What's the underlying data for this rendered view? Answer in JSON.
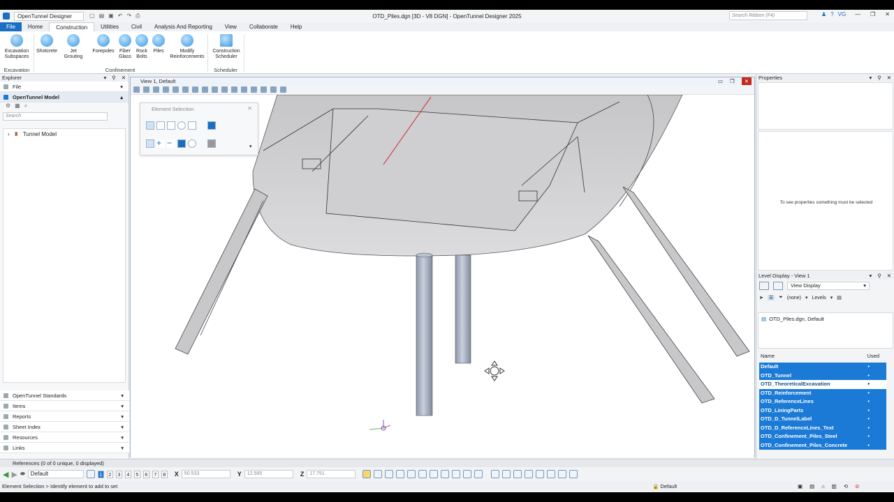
{
  "app": {
    "name": "OpenTunnel Designer",
    "document_title": "OTD_Piles.dgn [3D - V8 DGN] - OpenTunnel Designer 2025",
    "search_placeholder": "Search Ribbon (F4)",
    "user_initials": "VG"
  },
  "tabs": [
    "File",
    "Home",
    "Construction",
    "Utilities",
    "Civil",
    "Analysis And Reporting",
    "View",
    "Collaborate",
    "Help"
  ],
  "active_tab": "Construction",
  "ribbon": {
    "groups": [
      {
        "label": "Excavation",
        "buttons": [
          {
            "label": "Excavation\nSubspaces",
            "icon": "excavation-icon"
          }
        ]
      },
      {
        "label": "Confinement",
        "buttons": [
          {
            "label": "Shotcrete",
            "icon": "shotcrete-icon"
          },
          {
            "label": "Jet\nGrouting",
            "icon": "jet-grouting-icon"
          },
          {
            "label": "Forepoles",
            "icon": "forepoles-icon"
          },
          {
            "label": "Fiber\nGlass",
            "icon": "fiber-glass-icon"
          },
          {
            "label": "Rock\nBolts",
            "icon": "rock-bolts-icon"
          },
          {
            "label": "Piles",
            "icon": "piles-icon"
          },
          {
            "label": "Modify\nReinforcements",
            "icon": "modify-reinforcements-icon"
          }
        ]
      },
      {
        "label": "Scheduler",
        "buttons": [
          {
            "label": "Construction\nScheduler",
            "icon": "scheduler-icon"
          }
        ]
      }
    ]
  },
  "explorer": {
    "title": "Explorer",
    "file_section": "File",
    "active_section": "OpenTunnel Model",
    "search_placeholder": "Search",
    "tree_root": "Tunnel Model",
    "bottom_sections": [
      "OpenTunnel Standards",
      "Items",
      "Reports",
      "Sheet Index",
      "Resources",
      "Links"
    ]
  },
  "view": {
    "title": "View 1, Default"
  },
  "element_selection": {
    "title": "Element Selection"
  },
  "properties": {
    "title": "Properties",
    "empty_message": "To see properties something must be selected"
  },
  "level_display": {
    "title": "Level Display - View 1",
    "mode": "View Display",
    "filter": "(none)",
    "levels_label": "Levels",
    "file_entry": "OTD_Piles.dgn, Default",
    "col_name": "Name",
    "col_used": "Used",
    "levels": [
      {
        "name": "Default",
        "on": true
      },
      {
        "name": "OTD_Tunnel",
        "on": true
      },
      {
        "name": "OTD_TheoreticalExcavation",
        "on": false
      },
      {
        "name": "OTD_Reinforcement",
        "on": true
      },
      {
        "name": "OTD_ReferenceLines",
        "on": true
      },
      {
        "name": "OTD_LiningParts",
        "on": true
      },
      {
        "name": "OTD_D_TunnelLabel",
        "on": true
      },
      {
        "name": "OTD_D_ReferenceLines_Text",
        "on": true
      },
      {
        "name": "OTD_Confinement_Piles_Steel",
        "on": true
      },
      {
        "name": "OTD_Confinement_Piles_Concrete",
        "on": true
      }
    ]
  },
  "references_bar": "References (0 of 0 unique, 0 displayed)",
  "tool_tray": {
    "active_model": "Default",
    "view_numbers": [
      "1",
      "2",
      "3",
      "4",
      "5",
      "6",
      "7",
      "8"
    ],
    "x_label": "X",
    "x_value": "50.533",
    "y_label": "Y",
    "y_value": "12.585",
    "z_label": "Z",
    "z_value": "17.751"
  },
  "status": {
    "prompt": "Element Selection > Identify element to add to set",
    "active_level": "Default"
  },
  "colors": {
    "accent": "#1a7ad6",
    "file_tab": "#1a6fc2",
    "close_red": "#c42b1c"
  }
}
